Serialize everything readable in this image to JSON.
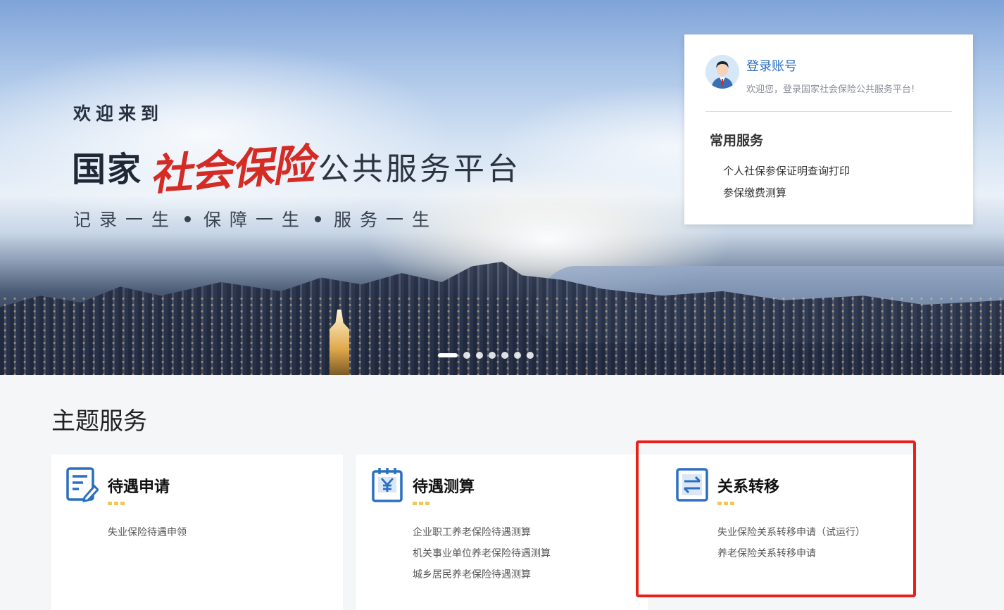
{
  "hero": {
    "welcome": "欢迎来到",
    "title_part1": "国家",
    "title_part2": "社会保险",
    "title_part3": "公共服务平台",
    "slogan": [
      "记录一生",
      "保障一生",
      "服务一生"
    ],
    "carousel": {
      "total": 7,
      "active": 1
    }
  },
  "login": {
    "link_label": "登录账号",
    "welcome_text": "欢迎您，登录国家社会保险公共服务平台!",
    "common_title": "常用服务",
    "common_items": [
      "个人社保参保证明查询打印",
      "参保缴费测算"
    ]
  },
  "theme": {
    "title": "主题服务",
    "cards": [
      {
        "name": "待遇申请",
        "icon": "form-edit-icon",
        "items": [
          "失业保险待遇申领"
        ]
      },
      {
        "name": "待遇测算",
        "icon": "calculator-yen-icon",
        "items": [
          "企业职工养老保险待遇测算",
          "机关事业单位养老保险待遇测算",
          "城乡居民养老保险待遇测算"
        ]
      },
      {
        "name": "关系转移",
        "icon": "transfer-arrows-icon",
        "items": [
          "失业保险关系转移申请（试运行）",
          "养老保险关系转移申请"
        ]
      }
    ]
  },
  "colors": {
    "accent_blue": "#2a6fc1",
    "title_red": "#d42b25",
    "highlight_red": "#e8201a",
    "dot_yellow": "#f1c75a"
  }
}
